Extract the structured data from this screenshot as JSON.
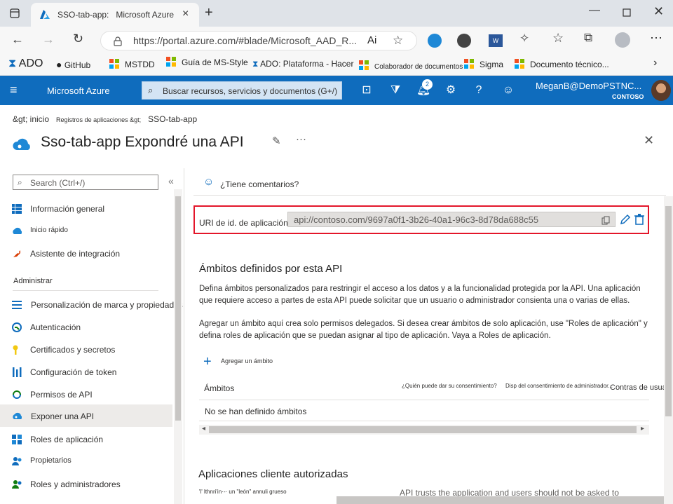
{
  "browser": {
    "tab_title_part1": "SSO-tab-app:",
    "tab_title_part2": "Microsoft Azure",
    "url": "https://portal.azure.com/#blade/Microsoft_AAD_R...",
    "reader_label": "Ai",
    "bookmarks": [
      {
        "label": "ADO",
        "icon": "ado-icon"
      },
      {
        "label": "GitHub",
        "icon": "github-icon"
      },
      {
        "label": "MSTDD",
        "icon": "ms-logo-icon"
      },
      {
        "label": "Guía de MS-Style",
        "icon": "ms-logo-icon"
      },
      {
        "label": "ADO: Plataforma - Hacer",
        "icon": "ado-icon"
      },
      {
        "label": "Colaborador de documentos",
        "icon": "ms-logo-icon"
      },
      {
        "label": "Sigma",
        "icon": "ms-logo-icon"
      },
      {
        "label": "Documento técnico...",
        "icon": "ms-logo-icon"
      }
    ]
  },
  "azure": {
    "brand": "Microsoft Azure",
    "search_placeholder": "Buscar recursos, servicios y documentos (G+/)",
    "notification_count": "2",
    "user_name": "MeganB@DemoPSTNC...",
    "tenant": "CONTOSO"
  },
  "breadcrumb": {
    "home": "&gt; inicio",
    "registrations": "Registros de aplicaciones &gt;",
    "current": "SSO-tab-app"
  },
  "page": {
    "title": "Sso-tab-app Expondré una API"
  },
  "sidebar": {
    "search_placeholder": "Search (Ctrl+/)",
    "items_top": [
      {
        "label": "Información general",
        "icon": "overview-icon"
      },
      {
        "label": "Inicio rápido",
        "icon": "quickstart-icon"
      },
      {
        "label": "Asistente de integración",
        "icon": "rocket-icon"
      }
    ],
    "section_manage": "Administrar",
    "items_manage": [
      {
        "label": "Personalización de marca y propiedades",
        "icon": "branding-icon"
      },
      {
        "label": "Autenticación",
        "icon": "authentication-icon"
      },
      {
        "label": "Certificados y secretos",
        "icon": "key-icon"
      },
      {
        "label": "Configuración de token",
        "icon": "token-icon"
      },
      {
        "label": "Permisos de API",
        "icon": "api-permissions-icon"
      },
      {
        "label": "Exponer una API",
        "icon": "expose-api-icon"
      },
      {
        "label": "Roles de aplicación",
        "icon": "app-roles-icon"
      },
      {
        "label": "Propietarios",
        "icon": "owners-icon"
      },
      {
        "label": "Roles y administradores",
        "icon": "roles-admins-icon"
      }
    ]
  },
  "content": {
    "feedback": "¿Tiene comentarios?",
    "uri_label": "URI de id. de aplicación",
    "uri_value": "api://contoso.com/9697a0f1-3b26-40a1-96c3-8d78da688c55",
    "scopes_heading": "Ámbitos definidos por esta API",
    "scopes_desc1": "Defina ámbitos personalizados para restringir el acceso a los datos y a la funcionalidad protegida por la API. Una aplicación que requiere acceso a partes de esta API puede solicitar que un usuario o administrador consienta una o varias de ellas.",
    "scopes_desc2": "Agregar un ámbito aquí crea solo permisos delegados. Si desea crear ámbitos de solo aplicación, use \"Roles de aplicación\" y defina roles de aplicación que se puedan asignar al tipo de aplicación. Vaya a Roles de aplicación.",
    "add_scope": "Agregar un ámbito",
    "table_headers": [
      "Ámbitos",
      "¿Quién puede dar su consentimiento?",
      "Disp del consentimiento de administrador...",
      "Contras de usuario"
    ],
    "empty_row": "No se han definido ámbitos",
    "clients_heading": "Aplicaciones cliente autorizadas",
    "clients_small": "'l' lthnri'in·-· un \"león\" annuli grueso",
    "clients_desc": "API trusts the application and users should not be asked to"
  }
}
